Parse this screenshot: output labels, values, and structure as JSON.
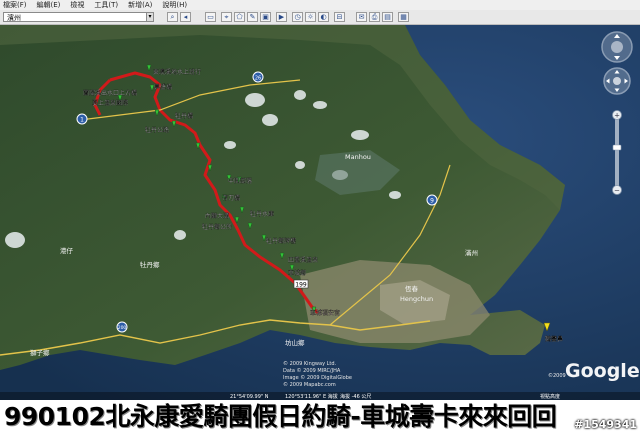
{
  "menu": [
    "檔案(F)",
    "編輯(E)",
    "檢視",
    "工具(T)",
    "新增(A)",
    "說明(H)"
  ],
  "search": {
    "value": "濱州"
  },
  "map": {
    "waypoints": [
      "蘭陽溪出水口上方橋",
      "興盛橋",
      "東澳溪地水上班行",
      "夏上溫泉國際",
      "牡丹公路",
      "牡丹橋",
      "中間部落",
      "青刀橋",
      "牡丹水庫",
      "內獅大溝",
      "牡丹鄉公所",
      "牡丹鄉牌樓",
      "四重溪溫泉",
      "車城鄉",
      "車城福安宮",
      "鵝鑾鼻"
    ],
    "place_labels": [
      "Manhou",
      "恆春",
      "Hengchun",
      "牡丹鄉",
      "滿州",
      "港仔",
      "獅子鄉",
      "坊山鄉"
    ],
    "road_shields": [
      "9",
      "26",
      "199",
      "1",
      "200"
    ],
    "copyright": [
      "© 2009 Kingway Ltd.",
      "Data © 2009 MIRC/JHA",
      "Image © 2009 DigitalGlobe",
      "© 2009 Mapabc.com"
    ],
    "status_left": "21°54'09.99\" N",
    "status_mid": "120°53'11.96\" E  海拔",
    "status_right": "海拔 -46 公尺",
    "logo": "Google",
    "logo_small": "©2009",
    "eye_alt": "視點高度"
  },
  "caption": "990102北永康愛騎團假日約騎-車城壽卡來來回回",
  "watermark": "#1549341"
}
